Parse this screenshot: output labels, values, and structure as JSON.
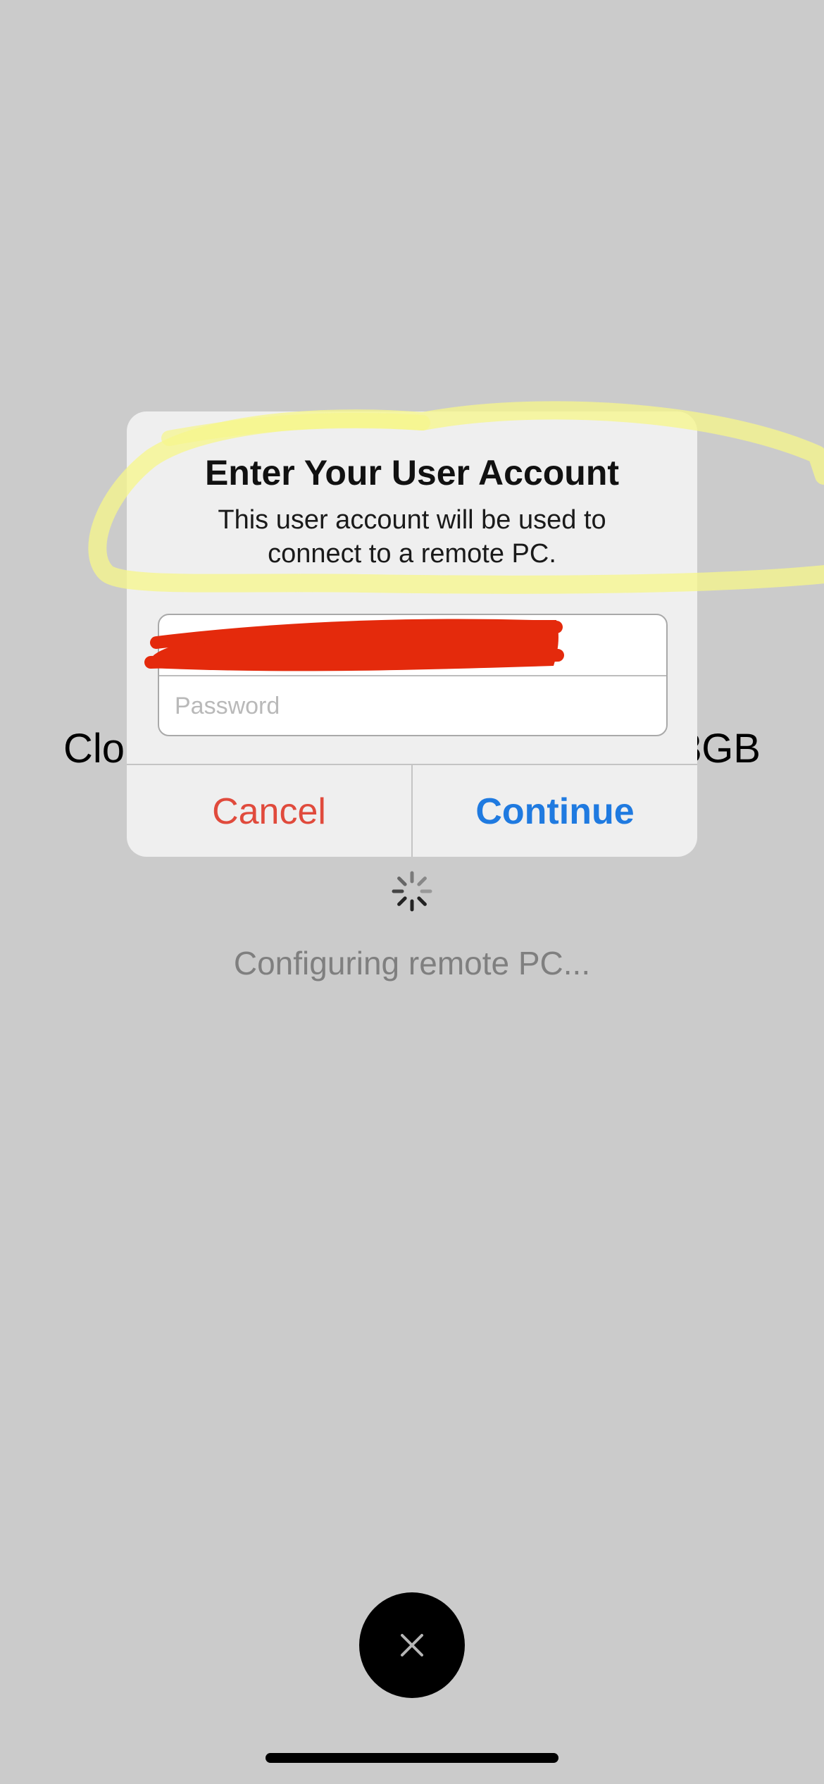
{
  "background": {
    "title_left": "Clo",
    "title_right": "3GB",
    "status_text": "Configuring remote PC..."
  },
  "dialog": {
    "title": "Enter Your User Account",
    "message": "This user account will be used to connect to a remote PC.",
    "username_value": "",
    "password_placeholder": "Password",
    "cancel_label": "Cancel",
    "continue_label": "Continue"
  },
  "icons": {
    "spinner": "activity-spinner-icon",
    "close": "close-icon"
  },
  "colors": {
    "background": "#cbcbcb",
    "cancel": "#e04a3c",
    "continue": "#1f7ae0",
    "redaction": "#e42a0c",
    "highlight": "#f5f59a"
  }
}
